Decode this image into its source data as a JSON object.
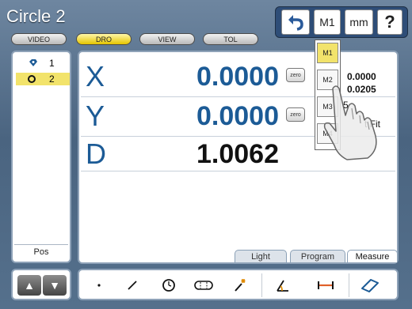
{
  "title": "Circle 2",
  "modes": [
    "VIDEO",
    "DRO",
    "VIEW",
    "TOL"
  ],
  "active_mode": "DRO",
  "toolbar": {
    "m_label": "M1",
    "unit_label": "mm",
    "help_label": "?"
  },
  "features": [
    {
      "num": "1",
      "icon": "point-icon"
    },
    {
      "num": "2",
      "icon": "circle-icon",
      "selected": true
    }
  ],
  "pos_label": "Pos",
  "dro": {
    "rows": [
      {
        "axis": "X",
        "value": "0.0000",
        "zero": "zero"
      },
      {
        "axis": "Y",
        "value": "0.0000",
        "zero": "zero"
      },
      {
        "axis": "D",
        "value": "1.0062"
      }
    ],
    "info_values": [
      "0.0000",
      "0.0205"
    ],
    "info_partial_1": "5",
    "info_partial_2": "t Fit"
  },
  "tabs": [
    "Light",
    "Program",
    "Measure"
  ],
  "active_tab": "Measure",
  "m_menu": [
    "M1",
    "M2",
    "M3",
    "M4"
  ],
  "m_selected": "M1",
  "tools": [
    "point-icon",
    "line-icon",
    "circle-icon",
    "slot-icon",
    "magic-wand-icon",
    "angle-icon",
    "distance-icon",
    "skew-icon"
  ],
  "colors": {
    "accent": "#1c5b96",
    "highlight": "#f2e36b",
    "frame": "#2e4d77"
  }
}
